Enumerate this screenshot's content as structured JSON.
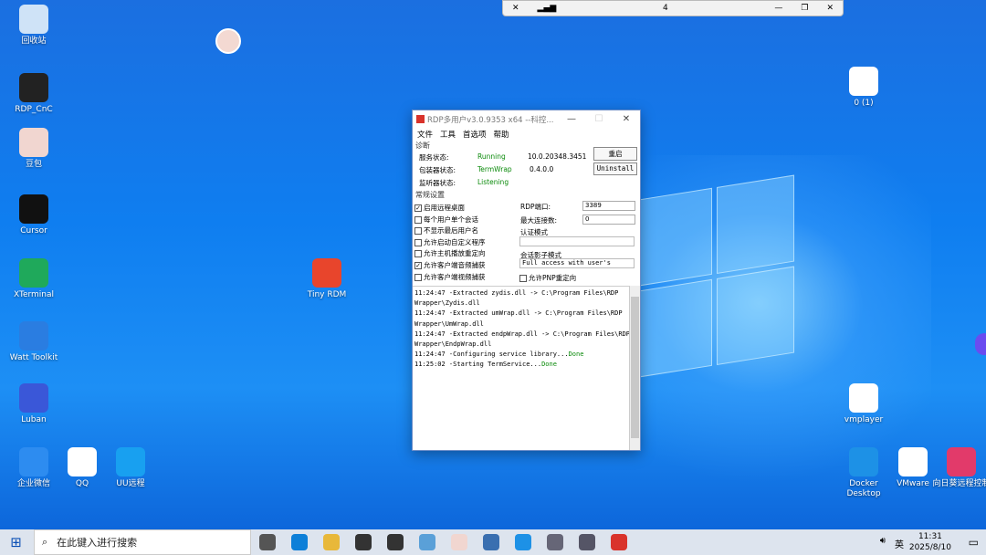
{
  "desktop_icons": [
    {
      "label": "回收站",
      "icon": "recycle-bin-icon",
      "color": "#cfe3f7"
    },
    {
      "label": "RDP_CnC",
      "icon": "rdp-cnc-icon",
      "color": "#222222"
    },
    {
      "label": "豆包",
      "icon": "doubao-icon",
      "color": "#f1d6d0"
    },
    {
      "label": "Cursor",
      "icon": "cursor-icon",
      "color": "#111111"
    },
    {
      "label": "XTerminal",
      "icon": "xterminal-icon",
      "color": "#1fa95b"
    },
    {
      "label": "Watt Toolkit",
      "icon": "watt-toolkit-icon",
      "color": "#2a7de1"
    },
    {
      "label": "Luban",
      "icon": "luban-icon",
      "color": "#3a57d8"
    },
    {
      "label": "企业微信",
      "icon": "wecom-icon",
      "color": "#2d8cf0"
    },
    {
      "label": "QQ",
      "icon": "qq-icon",
      "color": "#ffffff"
    },
    {
      "label": "UU远程",
      "icon": "uu-remote-icon",
      "color": "#18a0f0"
    },
    {
      "label": "Tiny RDM",
      "icon": "tiny-rdm-icon",
      "color": "#e8452c"
    },
    {
      "label": "0 (1)",
      "icon": "file-icon",
      "color": "#ffffff"
    },
    {
      "label": "vmplayer",
      "icon": "file-icon",
      "color": "#ffffff"
    },
    {
      "label": "Docker Desktop",
      "icon": "docker-icon",
      "color": "#1d91e6"
    },
    {
      "label": "VMware",
      "icon": "file-icon",
      "color": "#ffffff"
    },
    {
      "label": "向日葵远程控制",
      "icon": "sunlogin-icon",
      "color": "#e23a6a"
    }
  ],
  "rdp_bar": {
    "connection": "4"
  },
  "window": {
    "title": "RDP多用户v3.0.9353 x64 --科控...",
    "menu": [
      "文件",
      "工具",
      "首选项",
      "帮助"
    ],
    "diag_label": "诊断",
    "diag": [
      {
        "label": "服务状态:",
        "status": "Running",
        "value": "10.0.20348.3451"
      },
      {
        "label": "包装器状态:",
        "status": "TermWrap",
        "value": "0.4.0.0"
      },
      {
        "label": "监听器状态:",
        "status": "Listening",
        "value": ""
      }
    ],
    "restart_label": "重启",
    "uninstall_label": "Uninstall",
    "general_label": "常规设置",
    "checks": [
      {
        "label": "启用远程桌面",
        "checked": true
      },
      {
        "label": "每个用户单个会话",
        "checked": false
      },
      {
        "label": "不显示最后用户名",
        "checked": false
      },
      {
        "label": "允许启动自定义程序",
        "checked": false
      },
      {
        "label": "允许主机播放重定向",
        "checked": false
      },
      {
        "label": "允许客户端音频捕获",
        "checked": true
      },
      {
        "label": "允许客户端视频捕获",
        "checked": false
      }
    ],
    "rdp_port_label": "RDP端口:",
    "rdp_port": "3389",
    "max_conn_label": "最大连接数:",
    "max_conn": "0",
    "auth_label": "认证模式",
    "auth_value": "",
    "shadow_label": "会话影子模式",
    "shadow_value": "Full access with user's",
    "pnp_label": "允许PNP重定向",
    "pnp_checked": false,
    "log": [
      {
        "text": "11:24:47 -Extracted zydis.dll -> C:\\Program Files\\RDP",
        "done": ""
      },
      {
        "text": "Wrapper\\Zydis.dll",
        "done": ""
      },
      {
        "text": "11:24:47 -Extracted umWrap.dll -> C:\\Program Files\\RDP",
        "done": ""
      },
      {
        "text": "Wrapper\\UmWrap.dll",
        "done": ""
      },
      {
        "text": "11:24:47 -Extracted endpWrap.dll -> C:\\Program Files\\RDP",
        "done": ""
      },
      {
        "text": "Wrapper\\EndpWrap.dll",
        "done": ""
      },
      {
        "text": "11:24:47 -Configuring service library...",
        "done": "Done"
      },
      {
        "text": "11:25:02 -Starting TermService...",
        "done": "Done"
      }
    ]
  },
  "taskbar": {
    "search_placeholder": "在此键入进行搜索",
    "apps": [
      "task-view-icon",
      "edge-icon",
      "file-explorer-icon",
      "terminal-icon",
      "search-app-icon",
      "paint-icon",
      "doubao-icon",
      "server-manager-icon",
      "docker-icon",
      "settings-icon",
      "settings-alt-icon",
      "rdp-wrapper-icon"
    ],
    "ime": "英",
    "time": "11:31",
    "date": "2025/8/10"
  }
}
